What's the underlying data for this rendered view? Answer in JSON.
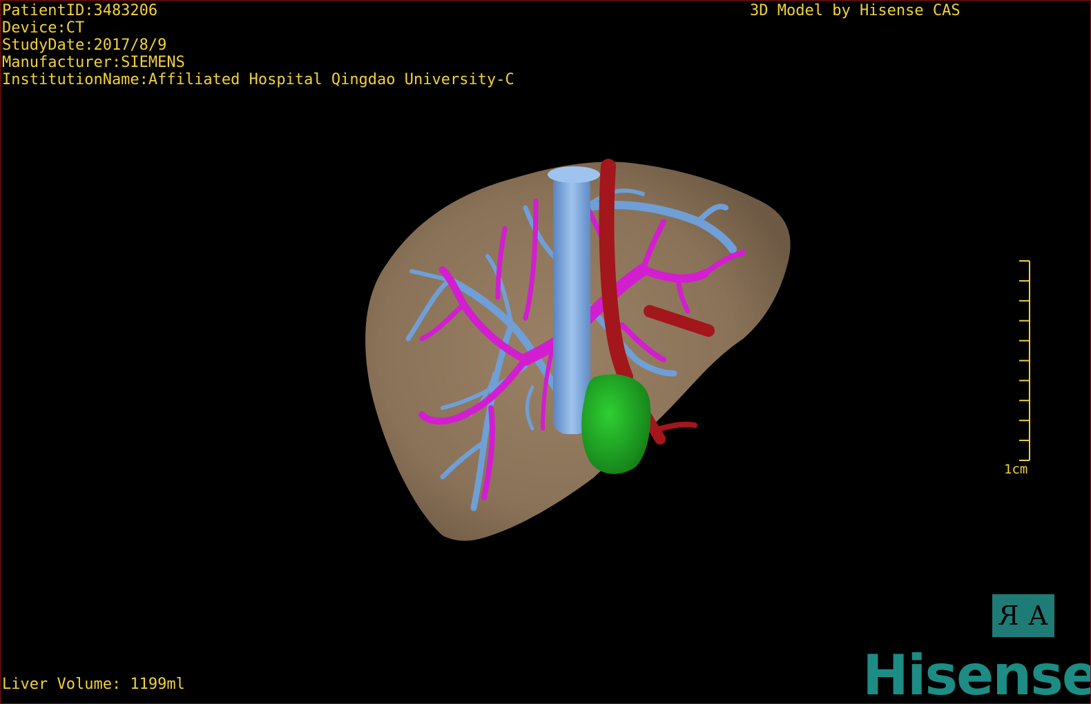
{
  "info": {
    "patient_id": "PatientID:3483206",
    "device": "Device:CT",
    "study_date": "StudyDate:2017/8/9",
    "manufacturer": "Manufacturer:SIEMENS",
    "institution": "InstitutionName:Affiliated Hospital Qingdao University-C"
  },
  "credit": "3D Model by Hisense CAS",
  "liver_volume": "Liver Volume: 1199ml",
  "scale": {
    "label": "1cm",
    "ticks": 10
  },
  "orientation": {
    "left": "R",
    "right": "A"
  },
  "brand": "Hisense",
  "colors": {
    "text": "#f2d23a",
    "liver": "#8a7258",
    "hepatic_vein": "#6f9fd6",
    "portal_vein": "#d21ed0",
    "artery": "#a3161b",
    "lesion": "#1aa31f",
    "brand": "#1c8c84",
    "orient_bg": "#1f7b76",
    "border": "#8a1010"
  }
}
